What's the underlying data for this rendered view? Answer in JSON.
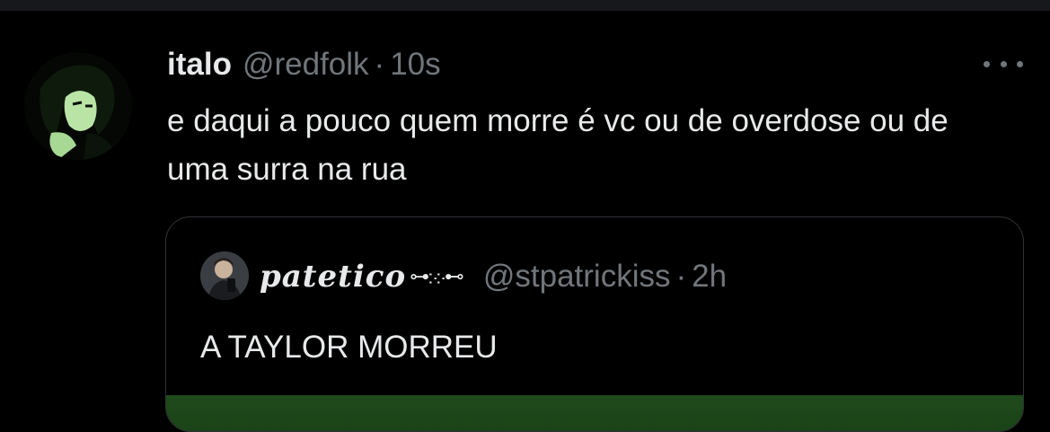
{
  "tweet": {
    "author_name": "italo",
    "author_handle": "@redfolk",
    "separator": "·",
    "timestamp": "10s",
    "text": "e daqui a pouco quem morre é vc ou de overdose ou de uma surra na rua",
    "more_icon": "more-horizontal-icon"
  },
  "quote": {
    "author_name": "pateticoᯓ჻჻ᯓ",
    "author_name_main": "patetico",
    "author_name_ornament": "⊶჻჻⊷",
    "author_handle": "@stpatrickiss",
    "separator": "·",
    "timestamp": "2h",
    "text": "A TAYLOR MORREU"
  },
  "colors": {
    "background": "#000000",
    "primary_text": "#e7e9ea",
    "secondary_text": "#71767b",
    "card_border": "#2f3336",
    "media_green": "#1f4a1c"
  }
}
